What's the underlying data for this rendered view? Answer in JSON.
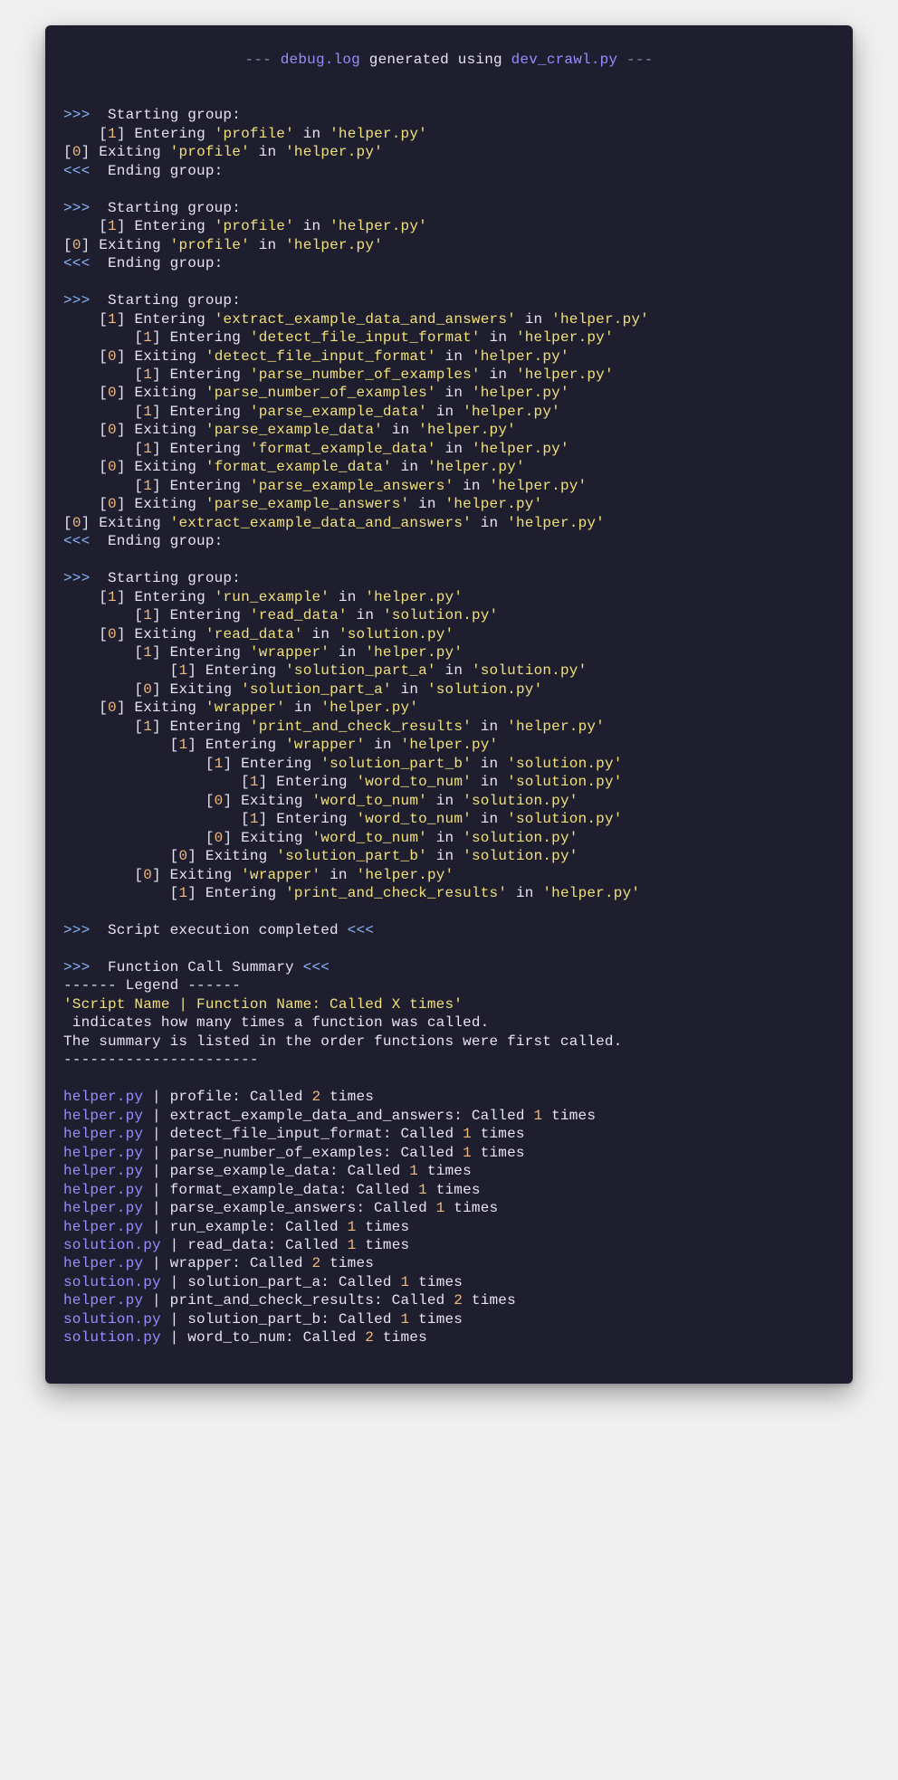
{
  "header": {
    "dash": "---",
    "file": "debug.log",
    "mid": " generated using ",
    "script": "dev_crawl.py"
  },
  "text": {
    "starting": "Starting group:",
    "ending": "Ending group:",
    "entering": "Entering",
    "exiting": "Exiting",
    "in": " in ",
    "execDone": "Script execution completed",
    "fcsHeader": "Function Call Summary",
    "legend": "------ Legend ------",
    "legendFmt": "'Script Name | Function Name: Called X times'",
    "legend1": " indicates how many times a function was called.",
    "legend2": "The summary is listed in the order functions were first called.",
    "dashLine": "----------------------",
    "called": "Called",
    "times": "times"
  },
  "groups": [
    {
      "events": [
        {
          "indent": 1,
          "type": "enter",
          "n": 1,
          "fn": "profile",
          "file": "helper.py"
        },
        {
          "indent": 0,
          "type": "exit",
          "n": 0,
          "fn": "profile",
          "file": "helper.py"
        }
      ]
    },
    {
      "events": [
        {
          "indent": 1,
          "type": "enter",
          "n": 1,
          "fn": "profile",
          "file": "helper.py"
        },
        {
          "indent": 0,
          "type": "exit",
          "n": 0,
          "fn": "profile",
          "file": "helper.py"
        }
      ]
    },
    {
      "events": [
        {
          "indent": 1,
          "type": "enter",
          "n": 1,
          "fn": "extract_example_data_and_answers",
          "file": "helper.py"
        },
        {
          "indent": 2,
          "type": "enter",
          "n": 1,
          "fn": "detect_file_input_format",
          "file": "helper.py"
        },
        {
          "indent": 1,
          "type": "exit",
          "n": 0,
          "fn": "detect_file_input_format",
          "file": "helper.py"
        },
        {
          "indent": 2,
          "type": "enter",
          "n": 1,
          "fn": "parse_number_of_examples",
          "file": "helper.py"
        },
        {
          "indent": 1,
          "type": "exit",
          "n": 0,
          "fn": "parse_number_of_examples",
          "file": "helper.py"
        },
        {
          "indent": 2,
          "type": "enter",
          "n": 1,
          "fn": "parse_example_data",
          "file": "helper.py"
        },
        {
          "indent": 1,
          "type": "exit",
          "n": 0,
          "fn": "parse_example_data",
          "file": "helper.py"
        },
        {
          "indent": 2,
          "type": "enter",
          "n": 1,
          "fn": "format_example_data",
          "file": "helper.py"
        },
        {
          "indent": 1,
          "type": "exit",
          "n": 0,
          "fn": "format_example_data",
          "file": "helper.py"
        },
        {
          "indent": 2,
          "type": "enter",
          "n": 1,
          "fn": "parse_example_answers",
          "file": "helper.py"
        },
        {
          "indent": 1,
          "type": "exit",
          "n": 0,
          "fn": "parse_example_answers",
          "file": "helper.py"
        },
        {
          "indent": 0,
          "type": "exit",
          "n": 0,
          "fn": "extract_example_data_and_answers",
          "file": "helper.py"
        }
      ]
    },
    {
      "noEnd": true,
      "events": [
        {
          "indent": 1,
          "type": "enter",
          "n": 1,
          "fn": "run_example",
          "file": "helper.py"
        },
        {
          "indent": 2,
          "type": "enter",
          "n": 1,
          "fn": "read_data",
          "file": "solution.py"
        },
        {
          "indent": 1,
          "type": "exit",
          "n": 0,
          "fn": "read_data",
          "file": "solution.py"
        },
        {
          "indent": 2,
          "type": "enter",
          "n": 1,
          "fn": "wrapper",
          "file": "helper.py"
        },
        {
          "indent": 3,
          "type": "enter",
          "n": 1,
          "fn": "solution_part_a",
          "file": "solution.py"
        },
        {
          "indent": 2,
          "type": "exit",
          "n": 0,
          "fn": "solution_part_a",
          "file": "solution.py"
        },
        {
          "indent": 1,
          "type": "exit",
          "n": 0,
          "fn": "wrapper",
          "file": "helper.py"
        },
        {
          "indent": 2,
          "type": "enter",
          "n": 1,
          "fn": "print_and_check_results",
          "file": "helper.py"
        },
        {
          "indent": 3,
          "type": "enter",
          "n": 1,
          "fn": "wrapper",
          "file": "helper.py"
        },
        {
          "indent": 4,
          "type": "enter",
          "n": 1,
          "fn": "solution_part_b",
          "file": "solution.py"
        },
        {
          "indent": 5,
          "type": "enter",
          "n": 1,
          "fn": "word_to_num",
          "file": "solution.py"
        },
        {
          "indent": 4,
          "type": "exit",
          "n": 0,
          "fn": "word_to_num",
          "file": "solution.py"
        },
        {
          "indent": 5,
          "type": "enter",
          "n": 1,
          "fn": "word_to_num",
          "file": "solution.py"
        },
        {
          "indent": 4,
          "type": "exit",
          "n": 0,
          "fn": "word_to_num",
          "file": "solution.py"
        },
        {
          "indent": 3,
          "type": "exit",
          "n": 0,
          "fn": "solution_part_b",
          "file": "solution.py"
        },
        {
          "indent": 2,
          "type": "exit",
          "n": 0,
          "fn": "wrapper",
          "file": "helper.py"
        },
        {
          "indent": 3,
          "type": "enter",
          "n": 1,
          "fn": "print_and_check_results",
          "file": "helper.py"
        }
      ]
    }
  ],
  "summary": [
    {
      "script": "helper.py",
      "fn": "profile",
      "count": 2
    },
    {
      "script": "helper.py",
      "fn": "extract_example_data_and_answers",
      "count": 1
    },
    {
      "script": "helper.py",
      "fn": "detect_file_input_format",
      "count": 1
    },
    {
      "script": "helper.py",
      "fn": "parse_number_of_examples",
      "count": 1
    },
    {
      "script": "helper.py",
      "fn": "parse_example_data",
      "count": 1
    },
    {
      "script": "helper.py",
      "fn": "format_example_data",
      "count": 1
    },
    {
      "script": "helper.py",
      "fn": "parse_example_answers",
      "count": 1
    },
    {
      "script": "helper.py",
      "fn": "run_example",
      "count": 1
    },
    {
      "script": "solution.py",
      "fn": "read_data",
      "count": 1
    },
    {
      "script": "helper.py",
      "fn": "wrapper",
      "count": 2
    },
    {
      "script": "solution.py",
      "fn": "solution_part_a",
      "count": 1
    },
    {
      "script": "helper.py",
      "fn": "print_and_check_results",
      "count": 2
    },
    {
      "script": "solution.py",
      "fn": "solution_part_b",
      "count": 1
    },
    {
      "script": "solution.py",
      "fn": "word_to_num",
      "count": 2
    }
  ]
}
